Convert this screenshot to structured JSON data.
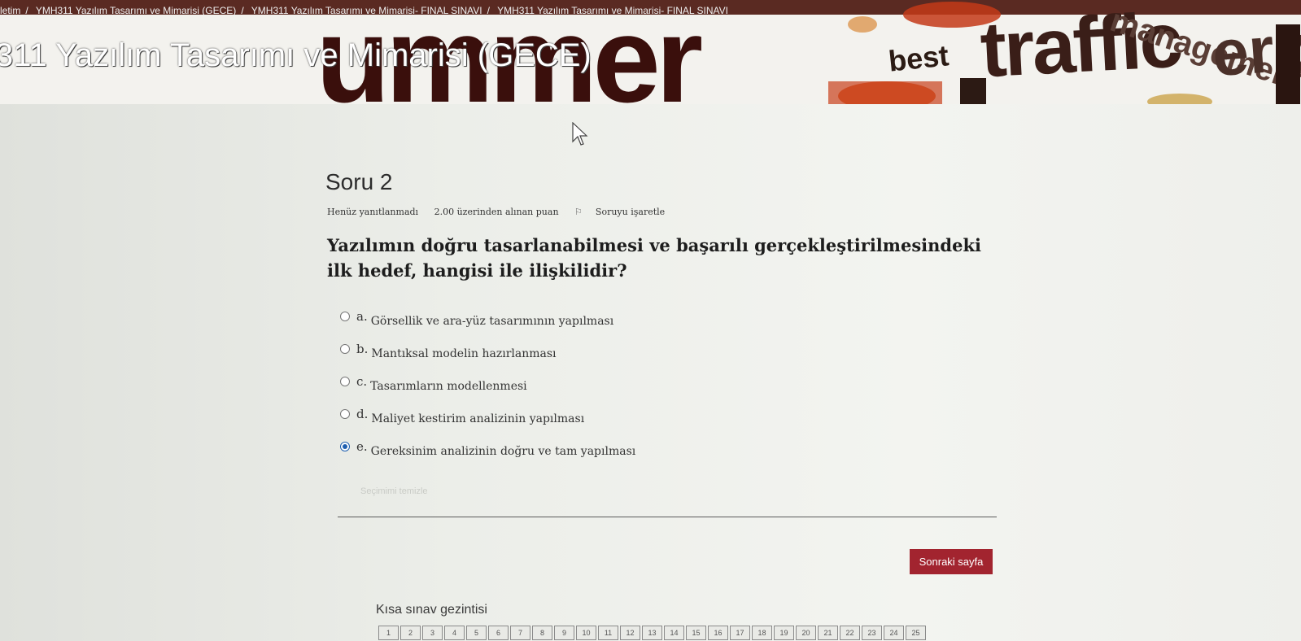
{
  "banner": {
    "breadcrumb": [
      "letim",
      "YMH311 Yazılım Tasarımı ve Mimarisi (GECE)",
      "YMH311 Yazılım Tasarımı ve Mimarisi- FINAL SINAVI",
      "YMH311 Yazılım Tasarımı ve Mimarisi- FINAL SINAVI"
    ],
    "course_title": "311 Yazılım Tasarımı ve Mimarisi (GECE)",
    "words": {
      "summer": "ummer",
      "best": "best",
      "traffic": "traffic",
      "management": "management",
      "erp": "erp"
    }
  },
  "question": {
    "title": "Soru 2",
    "status": "Henüz yanıtlanmadı",
    "points": "2.00 üzerinden alınan puan",
    "flag_label": "Soruyu işaretle",
    "text": "Yazılımın doğru tasarlanabilmesi ve başarılı gerçekleştirilmesindeki ilk hedef, hangisi ile ilişkilidir?",
    "answers": [
      {
        "letter": "a.",
        "text": "Görsellik ve ara-yüz tasarımının yapılması",
        "selected": false
      },
      {
        "letter": "b.",
        "text": "Mantıksal modelin hazırlanması",
        "selected": false
      },
      {
        "letter": "c.",
        "text": "Tasarımların modellenmesi",
        "selected": false
      },
      {
        "letter": "d.",
        "text": "Maliyet kestirim analizinin yapılması",
        "selected": false
      },
      {
        "letter": "e.",
        "text": "Gereksinim analizinin doğru ve tam yapılması",
        "selected": true
      }
    ],
    "clear_choice": "Seçimimi temizle"
  },
  "next_button": "Sonraki sayfa",
  "quiz_nav": {
    "title": "Kısa sınav gezintisi",
    "pages": [
      "1",
      "2",
      "3",
      "4",
      "5",
      "6",
      "7",
      "8",
      "9",
      "10",
      "11",
      "12",
      "13",
      "14",
      "15",
      "16",
      "17",
      "18",
      "19",
      "20",
      "21",
      "22",
      "23",
      "24",
      "25"
    ]
  },
  "colors": {
    "accent": "#a2242f",
    "radio_selected": "#1f5fb0"
  }
}
